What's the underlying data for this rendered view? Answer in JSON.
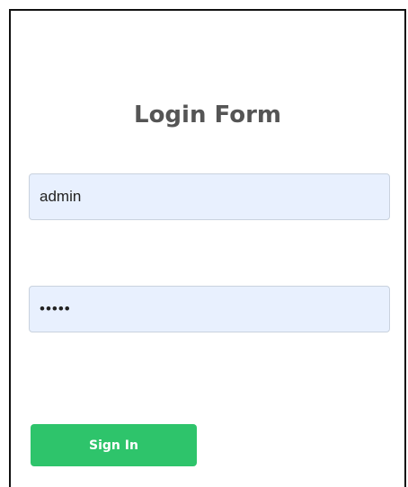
{
  "form": {
    "title": "Login Form",
    "username_value": "admin",
    "password_value": "abcde",
    "submit_label": "Sign In"
  },
  "colors": {
    "title": "#555555",
    "field_background": "#e8f0fe",
    "button_background": "#2ec46b",
    "button_text": "#ffffff"
  }
}
